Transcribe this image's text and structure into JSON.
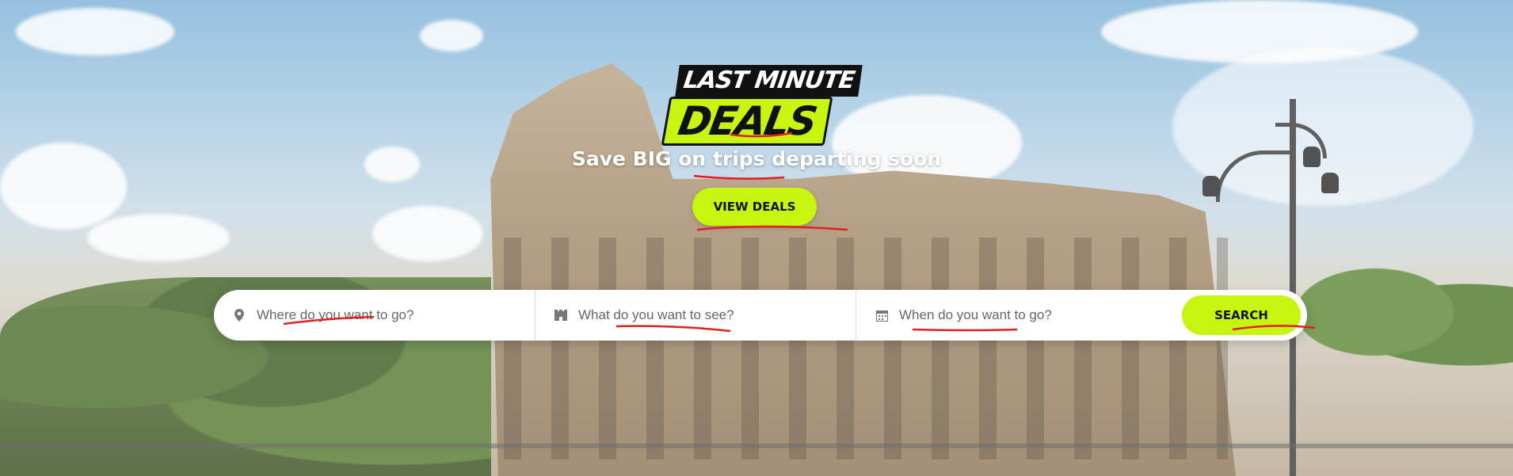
{
  "logo": {
    "line1": "LAST MINUTE",
    "line2": "DEALS"
  },
  "hero": {
    "tagline": "Save BIG on trips departing soon",
    "cta_label": "VIEW DEALS"
  },
  "search": {
    "destination_placeholder": "Where do you want to go?",
    "activity_placeholder": "What do you want to see?",
    "date_placeholder": "When do you want to go?",
    "submit_label": "SEARCH"
  },
  "colors": {
    "accent": "#c8f50f",
    "annotation": "#e02020"
  },
  "icons": {
    "destination": "map-pin-icon",
    "activity": "landmark-icon",
    "date": "calendar-icon"
  }
}
